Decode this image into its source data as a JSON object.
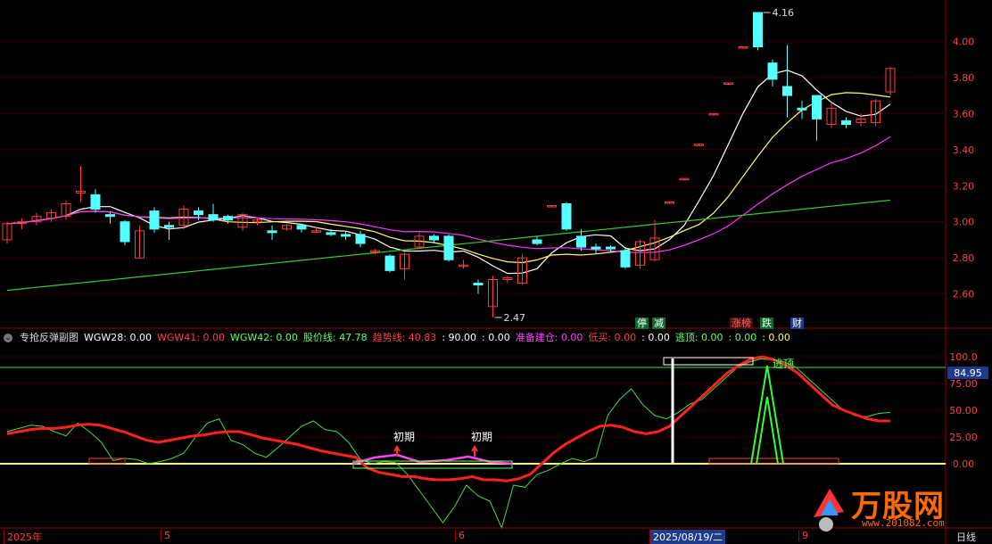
{
  "colors": {
    "bg": "#000000",
    "grid": "#7a0000",
    "up": "#ff3b3b",
    "down": "#54ffff",
    "ma5": "#ffffff",
    "ma10": "#ffff66",
    "ma20": "#ff33ff",
    "ma60": "#33cc33",
    "trend": "#ff2020",
    "pricelines": "#44dd44",
    "accent_blue": "#1e3a8a"
  },
  "price_axis": {
    "labels": [
      "4.00",
      "3.80",
      "3.60",
      "3.40",
      "3.20",
      "3.00",
      "2.80",
      "2.60"
    ],
    "min": 2.47,
    "max": 4.16
  },
  "price_annotations": {
    "high": "4.16",
    "low": "2.47"
  },
  "signal_tags": [
    {
      "text": "停",
      "color": "#ffffff",
      "bg": "#0b6b2a"
    },
    {
      "text": "减",
      "color": "#ffffff",
      "bg": "#0b6b2a"
    },
    {
      "text": "涨榜",
      "color": "#ff6666",
      "bg": "#4a1010"
    },
    {
      "text": "跌",
      "color": "#ffffff",
      "bg": "#0b6b2a"
    },
    {
      "text": "财",
      "color": "#ffffff",
      "bg": "#1e3a8a"
    }
  ],
  "indicator": {
    "name": "专抢反弹副图",
    "items": [
      {
        "label": "WGW28:",
        "value": "0.00",
        "color": "#ffffff"
      },
      {
        "label": "WGW41:",
        "value": "0.00",
        "color": "#ff4040"
      },
      {
        "label": "WGW42:",
        "value": "0.00",
        "color": "#66ff66"
      },
      {
        "label": "股价线:",
        "value": "47.78",
        "color": "#66ff66"
      },
      {
        "label": "趋势线:",
        "value": "40.83",
        "color": "#ff4040"
      },
      {
        "label": ":",
        "value": "90.00",
        "color": "#ffffff"
      },
      {
        "label": ":",
        "value": "0.00",
        "color": "#ffffff"
      },
      {
        "label": "准备建仓:",
        "value": "0.00",
        "color": "#ff44ff"
      },
      {
        "label": "低买:",
        "value": "0.00",
        "color": "#ff4040"
      },
      {
        "label": ":",
        "value": "0.00",
        "color": "#ffffff"
      },
      {
        "label": "逃顶:",
        "value": "0.00",
        "color": "#66ff66"
      },
      {
        "label": ":",
        "value": "0.00",
        "color": "#66ff66"
      },
      {
        "label": ":",
        "value": "0.00",
        "color": "#ffff66"
      }
    ],
    "axis_labels": [
      "100.0",
      "75.00",
      "50.00",
      "25.00",
      "0.00"
    ],
    "current_badge": "84.95",
    "markers": [
      {
        "text": "初期"
      },
      {
        "text": "初期"
      },
      {
        "text": "逃顶"
      }
    ]
  },
  "bottom_axis": {
    "labels": [
      "2025年",
      "5",
      "6",
      "2025/08/19/二",
      "9"
    ],
    "period": "日线"
  },
  "brand": {
    "text": "万股网",
    "url": "www.201082.com"
  },
  "chart_data": {
    "type": "candlestick",
    "title": "",
    "ylim": [
      2.47,
      4.16
    ],
    "candles": [
      [
        2.9,
        2.99,
        2.88,
        3.0
      ],
      [
        2.99,
        3.0,
        2.96,
        3.02
      ],
      [
        3.0,
        3.03,
        2.98,
        3.05
      ],
      [
        3.02,
        3.05,
        3.0,
        3.07
      ],
      [
        3.03,
        3.1,
        3.01,
        3.12
      ],
      [
        3.16,
        3.17,
        3.11,
        3.31
      ],
      [
        3.15,
        3.07,
        3.05,
        3.18
      ],
      [
        3.04,
        3.03,
        2.99,
        3.06
      ],
      [
        3.0,
        2.89,
        2.87,
        3.01
      ],
      [
        2.8,
        2.95,
        2.8,
        2.98
      ],
      [
        3.06,
        2.96,
        2.94,
        3.08
      ],
      [
        2.98,
        2.97,
        2.9,
        3.0
      ],
      [
        2.98,
        3.07,
        2.96,
        3.09
      ],
      [
        3.06,
        3.04,
        3.01,
        3.08
      ],
      [
        3.04,
        3.01,
        3.0,
        3.1
      ],
      [
        3.03,
        3.01,
        2.99,
        3.04
      ],
      [
        2.97,
        3.04,
        2.95,
        3.05
      ],
      [
        3.0,
        3.01,
        2.98,
        3.02
      ],
      [
        2.95,
        2.94,
        2.9,
        2.98
      ],
      [
        2.96,
        2.98,
        2.95,
        2.99
      ],
      [
        2.98,
        2.96,
        2.94,
        2.99
      ],
      [
        2.95,
        2.95,
        2.94,
        2.97
      ],
      [
        2.94,
        2.93,
        2.92,
        2.96
      ],
      [
        2.93,
        2.92,
        2.9,
        2.95
      ],
      [
        2.93,
        2.88,
        2.86,
        2.95
      ],
      [
        2.84,
        2.84,
        2.82,
        2.85
      ],
      [
        2.81,
        2.73,
        2.72,
        2.82
      ],
      [
        2.74,
        2.82,
        2.68,
        2.83
      ],
      [
        2.86,
        2.92,
        2.85,
        2.94
      ],
      [
        2.92,
        2.9,
        2.88,
        2.93
      ],
      [
        2.92,
        2.79,
        2.78,
        2.93
      ],
      [
        2.76,
        2.76,
        2.74,
        2.79
      ],
      [
        2.66,
        2.65,
        2.6,
        2.68
      ],
      [
        2.53,
        2.68,
        2.47,
        2.7
      ],
      [
        2.68,
        2.69,
        2.66,
        2.7
      ],
      [
        2.66,
        2.8,
        2.65,
        2.82
      ],
      [
        2.9,
        2.88,
        2.87,
        2.92
      ],
      [
        3.09,
        3.09,
        3.08,
        3.09
      ],
      [
        3.1,
        2.96,
        2.95,
        3.11
      ],
      [
        2.92,
        2.86,
        2.84,
        2.96
      ],
      [
        2.86,
        2.85,
        2.82,
        2.88
      ],
      [
        2.86,
        2.85,
        2.83,
        2.87
      ],
      [
        2.84,
        2.75,
        2.74,
        2.86
      ],
      [
        2.76,
        2.89,
        2.74,
        2.9
      ],
      [
        2.79,
        2.91,
        2.78,
        3.01
      ],
      [
        3.11,
        3.11,
        3.1,
        3.11
      ],
      [
        3.24,
        3.24,
        3.23,
        3.24
      ],
      [
        3.43,
        3.43,
        3.42,
        3.43
      ],
      [
        3.6,
        3.6,
        3.59,
        3.6
      ],
      [
        3.77,
        3.77,
        3.76,
        3.77
      ],
      [
        3.97,
        3.97,
        3.96,
        3.97
      ],
      [
        4.16,
        3.97,
        3.95,
        4.16
      ],
      [
        3.88,
        3.79,
        3.75,
        3.9
      ],
      [
        3.75,
        3.7,
        3.58,
        3.98
      ],
      [
        3.63,
        3.62,
        3.57,
        3.67
      ],
      [
        3.7,
        3.57,
        3.45,
        3.7
      ],
      [
        3.54,
        3.63,
        3.52,
        3.66
      ],
      [
        3.56,
        3.54,
        3.52,
        3.58
      ],
      [
        3.55,
        3.57,
        3.53,
        3.6
      ],
      [
        3.55,
        3.67,
        3.53,
        3.68
      ],
      [
        3.72,
        3.85,
        3.7,
        3.86
      ]
    ],
    "series": [
      {
        "name": "MA5"
      },
      {
        "name": "MA10"
      },
      {
        "name": "MA20"
      },
      {
        "name": "MA60"
      }
    ],
    "indicator_series": {
      "trend": [
        28,
        30,
        32,
        33,
        33,
        34,
        36,
        37,
        36,
        33,
        30,
        26,
        22,
        20,
        22,
        24,
        26,
        27,
        29,
        30,
        30,
        27,
        24,
        22,
        20,
        18,
        15,
        12,
        10,
        8,
        6,
        -4,
        -8,
        -10,
        -12,
        -12,
        -14,
        -15,
        -15,
        -14,
        -12,
        -15,
        -15,
        -16,
        -14,
        -10,
        0,
        10,
        18,
        24,
        30,
        35,
        36,
        34,
        30,
        28,
        30,
        35,
        45,
        55,
        65,
        75,
        85,
        92,
        98,
        100,
        97,
        92,
        85,
        75,
        65,
        55,
        50,
        46,
        42,
        40,
        40
      ],
      "price": [
        30,
        33,
        36,
        35,
        30,
        26,
        38,
        30,
        20,
        3,
        5,
        4,
        0,
        2,
        5,
        10,
        25,
        38,
        42,
        22,
        18,
        10,
        6,
        15,
        25,
        35,
        40,
        32,
        30,
        20,
        4,
        0,
        2,
        1,
        -10,
        -25,
        -40,
        -55,
        -40,
        -20,
        -30,
        -35,
        -60,
        -20,
        -22,
        -10,
        -6,
        0,
        5,
        2,
        6,
        45,
        60,
        70,
        55,
        45,
        42,
        48,
        56,
        60,
        70,
        80,
        90,
        95,
        98,
        97,
        95,
        90,
        80,
        70,
        60,
        50,
        45,
        44,
        47,
        48
      ]
    }
  }
}
